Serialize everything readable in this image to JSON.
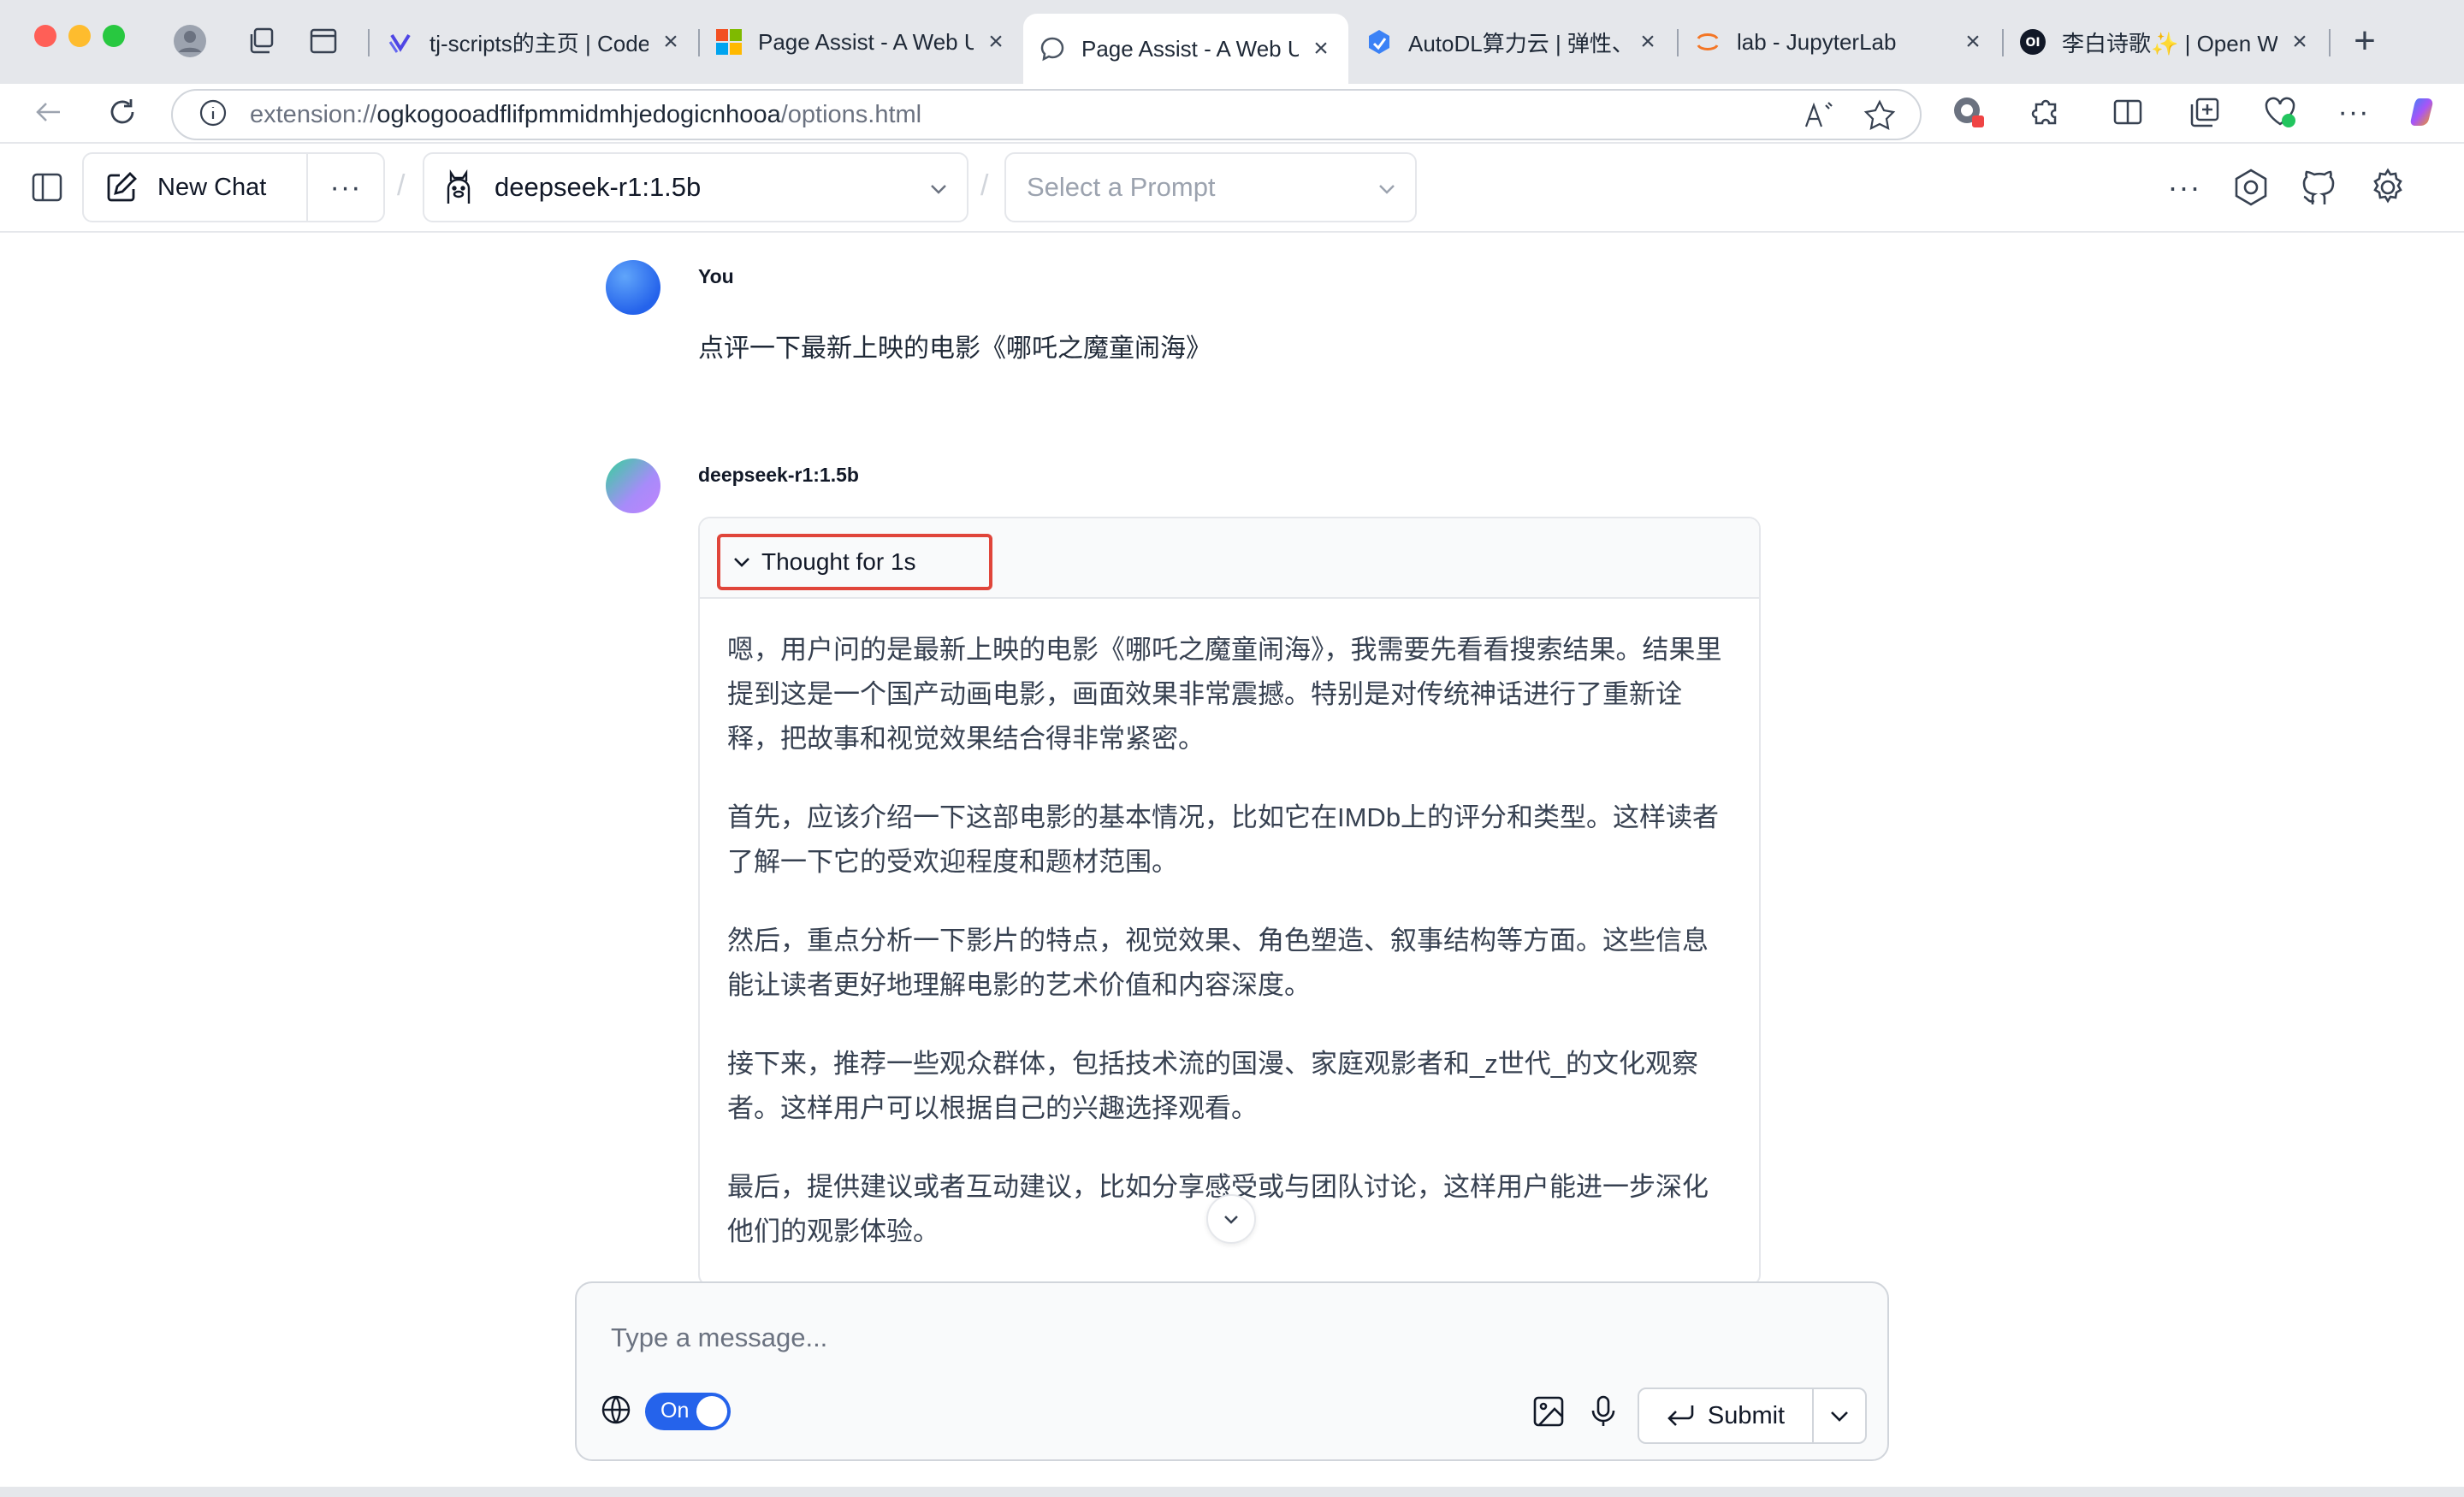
{
  "browser": {
    "tabs": [
      {
        "title": "tj-scripts的主页 | CodeWithGPU",
        "icon": "tj-scripts-icon",
        "active": false
      },
      {
        "title": "Page Assist - A Web UI",
        "icon": "microsoft-store-icon",
        "active": false
      },
      {
        "title": "Page Assist - A Web UI",
        "icon": "chat-bubble-icon",
        "active": true
      },
      {
        "title": "AutoDL算力云 | 弹性、好用",
        "icon": "autodl-icon",
        "active": false
      },
      {
        "title": "lab - JupyterLab",
        "icon": "jupyter-icon",
        "active": false
      },
      {
        "title": "李白诗歌✨ | Open WebUI",
        "icon": "open-webui-icon",
        "active": false
      }
    ],
    "address": {
      "scheme": "extension://",
      "host": "ogkogooadflifpmmidmhjedogicnhooa",
      "path": "/options.html"
    },
    "new_tab": "+"
  },
  "header": {
    "new_chat_label": "New Chat",
    "model_label": "deepseek-r1:1.5b",
    "prompt_placeholder": "Select a Prompt",
    "separator": "/"
  },
  "chat": {
    "user_name": "You",
    "user_message": "点评一下最新上映的电影《哪吒之魔童闹海》",
    "bot_name": "deepseek-r1:1.5b",
    "thought_label": "Thought for 1s",
    "thought_paragraphs": [
      "嗯，用户问的是最新上映的电影《哪吒之魔童闹海》，我需要先看看搜索结果。结果里提到这是一个国产动画电影，画面效果非常震撼。特别是对传统神话进行了重新诠释，把故事和视觉效果结合得非常紧密。",
      "首先，应该介绍一下这部电影的基本情况，比如它在IMDb上的评分和类型。这样读者了解一下它的受欢迎程度和题材范围。",
      "然后，重点分析一下影片的特点，视觉效果、角色塑造、叙事结构等方面。这些信息能让读者更好地理解电影的艺术价值和内容深度。",
      "接下来，推荐一些观众群体，包括技术流的国漫、家庭观影者和_z世代_的文化观察者。这样用户可以根据自己的兴趣选择观看。",
      "最后，提供建议或者互动建议，比如分享感受或与团队讨论，这样用户能进一步深化他们的观影体验。"
    ]
  },
  "composer": {
    "placeholder": "Type a message...",
    "web_search_toggle": "On",
    "submit_label": "Submit"
  },
  "colors": {
    "accent": "#2563eb",
    "highlight_box": "#e0453a",
    "chrome_bg": "#e5e7eb"
  }
}
